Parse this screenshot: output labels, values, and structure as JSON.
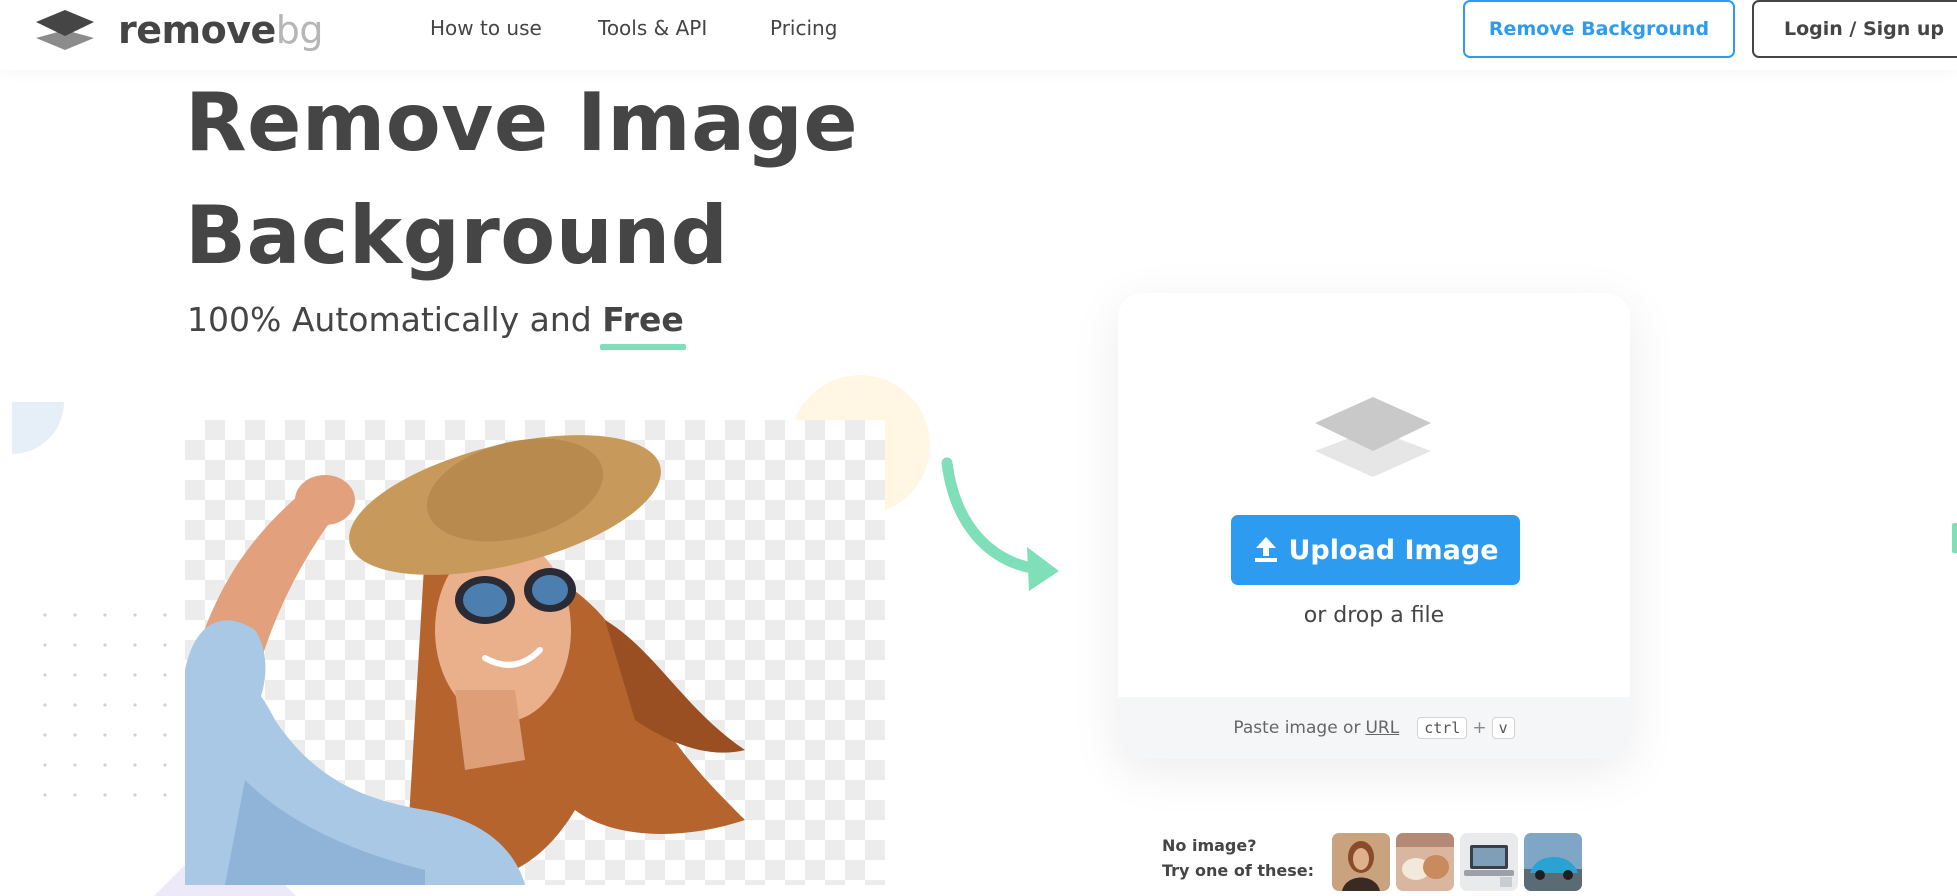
{
  "nav": {
    "logo_bold": "remove",
    "logo_light": "bg",
    "links": [
      "How to use",
      "Tools & API",
      "Pricing"
    ],
    "remove_bg_button": "Remove Background",
    "login_button": "Login / Sign up"
  },
  "hero": {
    "title_line1": "Remove Image",
    "title_line2": "Background",
    "subtitle_prefix": "100% Automatically and ",
    "subtitle_free": "Free"
  },
  "upload": {
    "button_label": "Upload Image",
    "drop_text": "or drop a file",
    "paste_text": "Paste image or",
    "url_link": "URL",
    "key_ctrl": "ctrl",
    "key_plus": "+",
    "key_v": "v"
  },
  "samples": {
    "prompt_line1": "No image?",
    "prompt_line2": "Try one of these:",
    "thumbnails": [
      "sample-woman-icon",
      "sample-animals-icon",
      "sample-laptop-icon",
      "sample-car-icon"
    ]
  },
  "colors": {
    "primary": "#2d9cf0",
    "text": "#454545",
    "accent_green": "#7fdfb8",
    "logo_light": "#b6b6b6"
  }
}
